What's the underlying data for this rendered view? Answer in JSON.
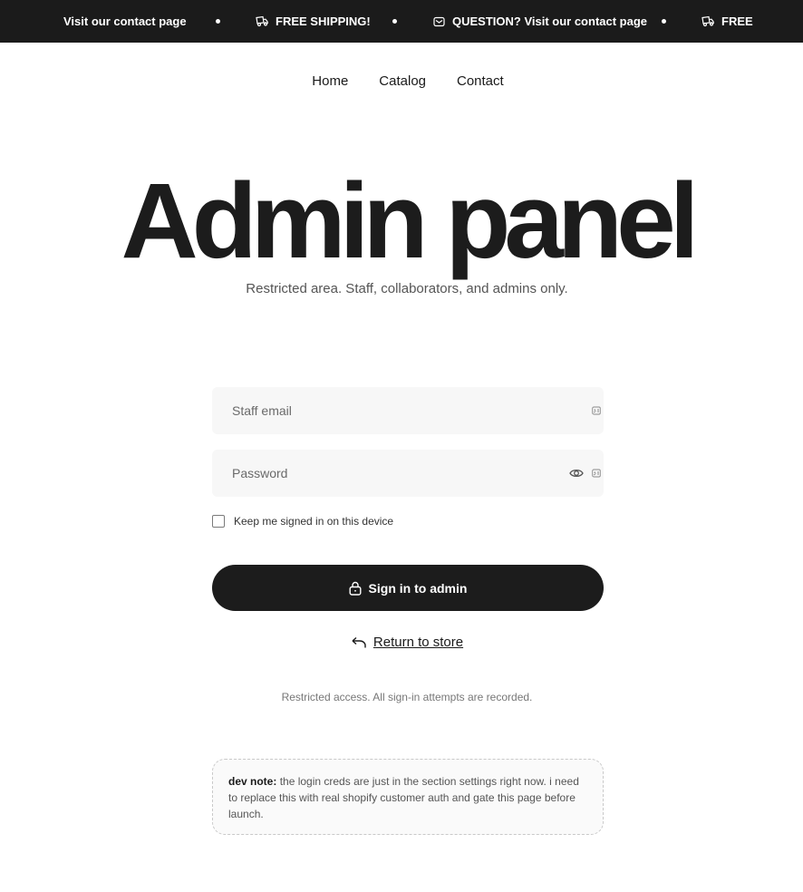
{
  "ticker": {
    "items": [
      {
        "label": "Visit our contact page",
        "icon": "mail-icon"
      },
      {
        "label": "FREE SHIPPING!",
        "icon": "truck-icon"
      },
      {
        "label": "QUESTION? Visit our contact page",
        "icon": "mail-icon"
      },
      {
        "label": "FREE",
        "icon": "truck-icon"
      }
    ]
  },
  "nav": {
    "items": [
      "Home",
      "Catalog",
      "Contact"
    ]
  },
  "hero": {
    "title": "Admin panel",
    "subtitle": "Restricted area. Staff, collaborators, and admins only."
  },
  "form": {
    "email_placeholder": "Staff email",
    "password_placeholder": "Password",
    "remember_label": "Keep me signed in on this device",
    "submit_label": "Sign in to admin",
    "return_label": "Return to store"
  },
  "notice": "Restricted access. All sign-in attempts are recorded.",
  "dev_note": {
    "label": "dev note:",
    "text": "the login creds are just in the section settings right now. i need to replace this with real shopify customer auth and gate this page before launch."
  },
  "colors": {
    "dark": "#1b1b1b",
    "field_bg": "#f7f7f7"
  }
}
